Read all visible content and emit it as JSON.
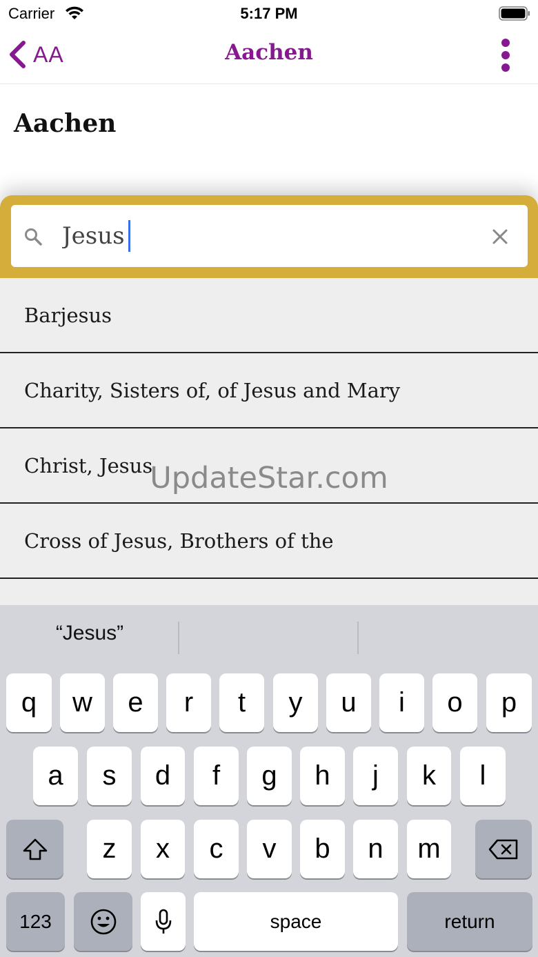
{
  "status_bar": {
    "carrier": "Carrier",
    "time": "5:17 PM",
    "wifi_icon": "wifi-icon",
    "battery_icon": "battery-full-icon"
  },
  "nav": {
    "back_label": "AA",
    "title": "Aachen",
    "back_icon": "chevron-left-icon",
    "more_icon": "more-vertical-icon",
    "accent_color": "#86198f"
  },
  "page": {
    "heading": "Aachen"
  },
  "search": {
    "value": "Jesus",
    "search_icon": "search-icon",
    "clear_icon": "close-icon",
    "panel_color": "#d4ad3a"
  },
  "results": [
    {
      "label": "Barjesus"
    },
    {
      "label": "Charity, Sisters of, of Jesus and Mary"
    },
    {
      "label": "Christ, Jesus"
    },
    {
      "label": "Cross of Jesus, Brothers of the"
    }
  ],
  "watermark": "UpdateStar.com",
  "keyboard": {
    "suggestions": [
      "“Jesus”",
      "",
      ""
    ],
    "row1": [
      "q",
      "w",
      "e",
      "r",
      "t",
      "y",
      "u",
      "i",
      "o",
      "p"
    ],
    "row2": [
      "a",
      "s",
      "d",
      "f",
      "g",
      "h",
      "j",
      "k",
      "l"
    ],
    "row3": [
      "z",
      "x",
      "c",
      "v",
      "b",
      "n",
      "m"
    ],
    "shift_icon": "shift-icon",
    "delete_icon": "backspace-icon",
    "numbers_label": "123",
    "emoji_icon": "emoji-icon",
    "mic_icon": "microphone-icon",
    "space_label": "space",
    "return_label": "return"
  }
}
